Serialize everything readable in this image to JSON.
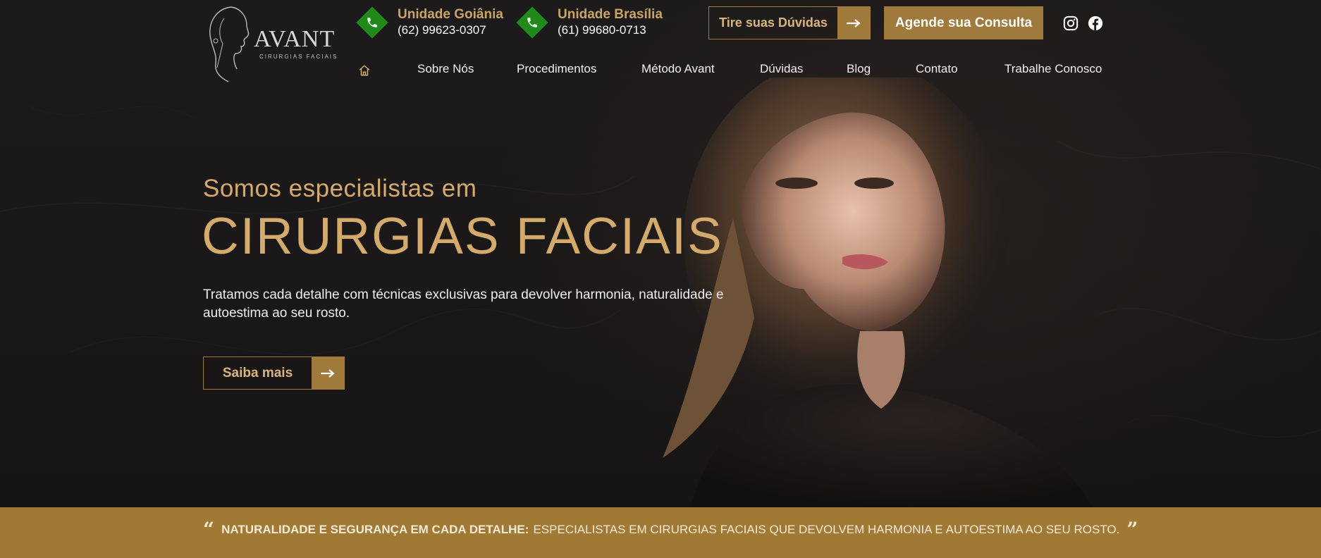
{
  "brand": {
    "name": "AVANT",
    "tagline": "CIRURGIAS FACIAIS"
  },
  "header": {
    "units": [
      {
        "title": "Unidade Goiânia",
        "phone": "(62) 99623-0307"
      },
      {
        "title": "Unidade Brasília",
        "phone": "(61) 99680-0713"
      }
    ],
    "duvidas_label": "Tire suas Dúvidas",
    "agende_label": "Agende sua Consulta"
  },
  "nav": {
    "items": [
      "Sobre Nós",
      "Procedimentos",
      "Método Avant",
      "Dúvidas",
      "Blog",
      "Contato",
      "Trabalhe Conosco"
    ]
  },
  "hero": {
    "kicker": "Somos especialistas em",
    "headline": "CIRURGIAS FACIAIS",
    "description": "Tratamos cada detalhe com técnicas exclusivas para devolver harmonia, naturalidade e autoestima ao seu rosto.",
    "cta_label": "Saiba mais"
  },
  "banner": {
    "open_quote": "“",
    "strong": "NATURALIDADE E SEGURANÇA EM CADA DETALHE:",
    "text": "ESPECIALISTAS EM CIRURGIAS FACIAIS QUE DEVOLVEM HARMONIA E AUTOESTIMA AO SEU ROSTO.",
    "close_quote": "”"
  },
  "colors": {
    "gold": "#a07a35",
    "gold_light": "#d4ab6a",
    "green": "#1f8a1a",
    "background": "#1a1818"
  },
  "icons": {
    "home": "home-icon",
    "phone": "phone-icon",
    "arrow": "arrow-right-icon",
    "instagram": "instagram-icon",
    "facebook": "facebook-icon"
  }
}
